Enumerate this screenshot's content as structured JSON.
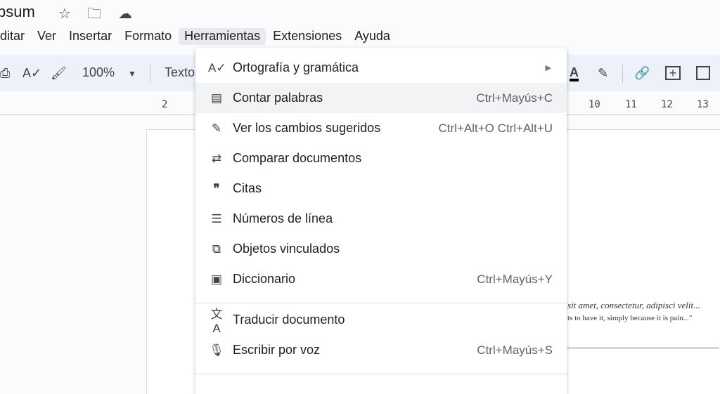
{
  "doc": {
    "title": "psum",
    "body_line1": "sit amet, consectetur, adipisci velit...",
    "body_line2": "ts to have it, simply because it is pain...\""
  },
  "menubar": [
    "ditar",
    "Ver",
    "Insertar",
    "Formato",
    "Herramientas",
    "Extensiones",
    "Ayuda"
  ],
  "toolbar": {
    "zoom": "100%",
    "style": "Texto"
  },
  "ruler": [
    "2",
    "10",
    "11",
    "12",
    "13"
  ],
  "menu": {
    "items": [
      {
        "label": "Ortografía y gramática",
        "shortcut": "",
        "icon": "spellcheck-icon",
        "submenu": true
      },
      {
        "label": "Contar palabras",
        "shortcut": "Ctrl+Mayús+C",
        "icon": "word-count-icon"
      },
      {
        "label": "Ver los cambios sugeridos",
        "shortcut": "Ctrl+Alt+O Ctrl+Alt+U",
        "icon": "suggested-edits-icon"
      },
      {
        "label": "Comparar documentos",
        "shortcut": "",
        "icon": "compare-icon"
      },
      {
        "label": "Citas",
        "shortcut": "",
        "icon": "quote-icon"
      },
      {
        "label": "Números de línea",
        "shortcut": "",
        "icon": "line-numbers-icon"
      },
      {
        "label": "Objetos vinculados",
        "shortcut": "",
        "icon": "linked-objects-icon"
      },
      {
        "label": "Diccionario",
        "shortcut": "Ctrl+Mayús+Y",
        "icon": "dictionary-icon"
      },
      {
        "label": "Traducir documento",
        "shortcut": "",
        "icon": "translate-icon"
      },
      {
        "label": "Escribir por voz",
        "shortcut": "Ctrl+Mayús+S",
        "icon": "microphone-icon"
      }
    ]
  }
}
